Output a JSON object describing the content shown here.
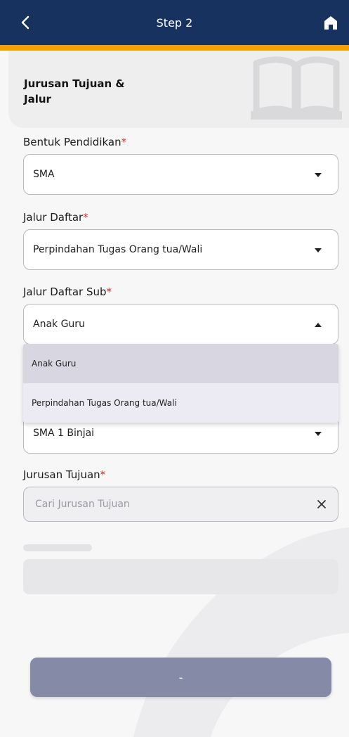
{
  "appbar": {
    "title": "Step 2",
    "bar_color": "#17325f",
    "stripe_color": "#f5a100"
  },
  "header": {
    "heading": "Jurusan Tujuan & Jalur"
  },
  "form": {
    "bentuk_pendidikan": {
      "label": "Bentuk Pendidikan",
      "required_mark": "*",
      "value": "SMA"
    },
    "jalur_daftar": {
      "label": "Jalur Daftar",
      "required_mark": "*",
      "value": "Perpindahan Tugas Orang tua/Wali"
    },
    "jalur_daftar_sub": {
      "label": "Jalur Daftar Sub",
      "required_mark": "*",
      "value": "Anak Guru",
      "options": [
        "Anak Guru",
        "Perpindahan Tugas Orang tua/Wali"
      ]
    },
    "sekolah": {
      "value": "SMA 1 Binjai"
    },
    "jurusan_tujuan": {
      "label": "Jurusan Tujuan",
      "required_mark": "*",
      "placeholder": "Cari Jurusan Tujuan"
    }
  },
  "submit": {
    "label": "-"
  }
}
